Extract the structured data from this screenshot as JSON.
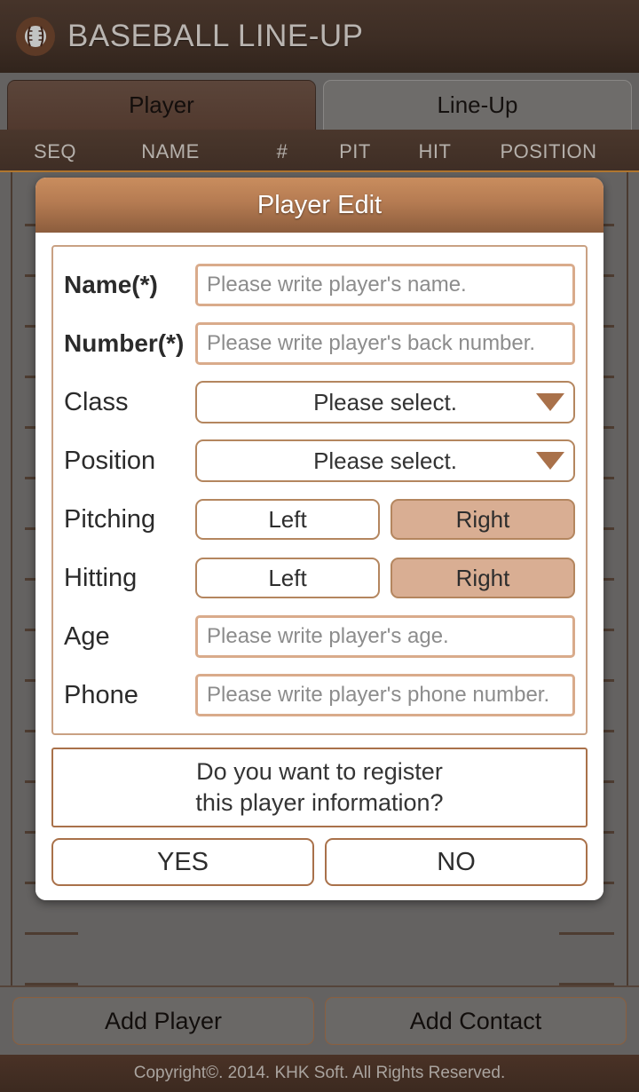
{
  "appbar": {
    "title": "BASEBALL LINE-UP",
    "icon": "baseball-icon"
  },
  "tabs": [
    {
      "label": "Player",
      "active": true
    },
    {
      "label": "Line-Up",
      "active": false
    }
  ],
  "table": {
    "columns": [
      "SEQ",
      "NAME",
      "#",
      "PIT",
      "HIT",
      "POSITION"
    ]
  },
  "dialog": {
    "title": "Player Edit",
    "fields": [
      {
        "label": "Name(*)",
        "required": true,
        "type": "input",
        "value": "",
        "placeholder": "Please write player's name."
      },
      {
        "label": "Number(*)",
        "required": true,
        "type": "input",
        "value": "",
        "placeholder": "Please write player's back number."
      },
      {
        "label": "Class",
        "required": false,
        "type": "select",
        "value": "Please select."
      },
      {
        "label": "Position",
        "required": false,
        "type": "select",
        "value": "Please select."
      },
      {
        "label": "Pitching",
        "required": false,
        "type": "segment",
        "options": [
          "Left",
          "Right"
        ],
        "selected": "Right"
      },
      {
        "label": "Hitting",
        "required": false,
        "type": "segment",
        "options": [
          "Left",
          "Right"
        ],
        "selected": "Right"
      },
      {
        "label": "Age",
        "required": false,
        "type": "input",
        "value": "",
        "placeholder": "Please write player's age."
      },
      {
        "label": "Phone",
        "required": false,
        "type": "input",
        "value": "",
        "placeholder": "Please write player's phone number."
      }
    ],
    "confirm_line1": "Do you want to register",
    "confirm_line2": "this player information?",
    "yes_label": "YES",
    "no_label": "NO"
  },
  "bottom": {
    "add_player_label": "Add Player",
    "add_contact_label": "Add Contact"
  },
  "footer": {
    "copyright": "Copyright©. 2014. KHK Soft. All Rights Reserved."
  },
  "colors": {
    "appbar_brown": "#3d2d24",
    "accent_brown": "#a9714a",
    "title_gradient_top": "#c98d5e",
    "title_gradient_bottom": "#8c5d3d",
    "selected_segment": "#d9ae93",
    "overlay_gray": "#646261",
    "input_border": "#d9ab8b"
  }
}
